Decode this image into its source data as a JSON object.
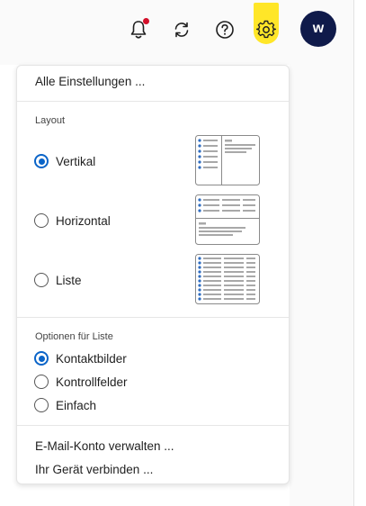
{
  "toolbar": {
    "icons": [
      "bell-icon",
      "sync-icon",
      "help-icon",
      "gear-icon"
    ],
    "avatar_initial": "w",
    "accent": "#ffe628",
    "notification_color": "#d3102a",
    "avatar_color": "#0f1a4a"
  },
  "menu": {
    "all_settings": "Alle Einstellungen ...",
    "layout": {
      "label": "Layout",
      "options": [
        {
          "label": "Vertikal",
          "checked": true
        },
        {
          "label": "Horizontal",
          "checked": false
        },
        {
          "label": "Liste",
          "checked": false
        }
      ]
    },
    "list_options": {
      "label": "Optionen für Liste",
      "options": [
        {
          "label": "Kontaktbilder",
          "checked": true
        },
        {
          "label": "Kontrollfelder",
          "checked": false
        },
        {
          "label": "Einfach",
          "checked": false
        }
      ]
    },
    "manage_account": "E-Mail-Konto verwalten ...",
    "connect_device": "Ihr Gerät verbinden ...",
    "radio_color": "#0a64c8"
  }
}
